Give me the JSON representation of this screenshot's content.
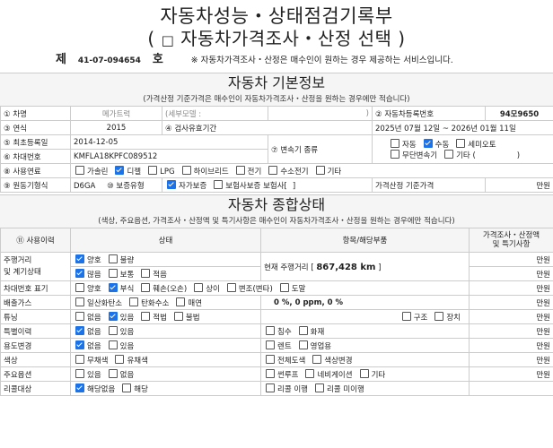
{
  "title": {
    "line1": "자동차성능・상태점검기록부",
    "line2_open": "( ",
    "line2_checkbox": "□",
    "line2_text": "자동차가격조사・산정 선택",
    "line2_close": " )"
  },
  "number_line": {
    "prefix": "제",
    "number": "41-07-094654",
    "suffix": "호",
    "note": "※ 자동차가격조사・산정은 매수인이 원하는 경우 제공하는 서비스입니다."
  },
  "basic_info": {
    "heading": "자동차 기본정보",
    "subheading": "(가격산정 기준가격은 매수인이 자동차가격조사・산정을 원하는 경우에만 적습니다)",
    "car_name_label": "① 차명",
    "car_name_value": "메가트럭",
    "detail_model_label": "(세부모델 :",
    "detail_model_close": ")",
    "reg_no_label": "② 자동차등록번호",
    "reg_no_value": "94모9650",
    "year_label": "③ 연식",
    "year_value": "2015",
    "inspection_label": "④ 검사유효기간",
    "inspection_value": "2025년 07월 12일 ~ 2026년 01월 11일",
    "first_reg_label": "⑤ 최초등록일",
    "first_reg_value": "2014-12-05",
    "vin_label": "⑥ 차대번호",
    "vin_value": "KMFLA18KPFC089512",
    "transmission_label": "⑦ 변속기 종류",
    "transmission_options": [
      {
        "label": "자동",
        "checked": false
      },
      {
        "label": "수동",
        "checked": true
      },
      {
        "label": "세미오토",
        "checked": false
      },
      {
        "label": "무단변속기",
        "checked": false
      },
      {
        "label": "기타 (",
        "checked": false
      }
    ],
    "transmission_other_close": ")",
    "fuel_label": "⑧ 사용연료",
    "fuel_options": [
      {
        "label": "가솔린",
        "checked": false
      },
      {
        "label": "디젤",
        "checked": true
      },
      {
        "label": "LPG",
        "checked": false
      },
      {
        "label": "하이브리드",
        "checked": false
      },
      {
        "label": "전기",
        "checked": false
      },
      {
        "label": "수소전기",
        "checked": false
      },
      {
        "label": "기타",
        "checked": false
      }
    ],
    "motor_label": "⑨ 원동기형식",
    "motor_value": "D6GA",
    "warranty_label": "⑩ 보증유형",
    "warranty_options": [
      {
        "label": "자가보증",
        "checked": true
      },
      {
        "label": "보험사보증 보험사[",
        "checked": false
      }
    ],
    "warranty_close": "]",
    "price_base_label": "가격산정 기준가격",
    "price_base_unit": "만원"
  },
  "overall_status": {
    "heading": "자동차 종합상태",
    "subheading": "(색상, 주요옵션, 가격조사・산정액 및 특기사항은 매수인이 자동차가격조사・산정을 원하는 경우에만 적습니다)",
    "col_usage": "⑪ 사용이력",
    "col_status": "상태",
    "col_items": "항목/해당부품",
    "col_price_line1": "가격조사・산정액",
    "col_price_line2": "및 특기사항",
    "unit": "만원",
    "mileage_label_1": "주행거리",
    "mileage_label_2": "및 계기상태",
    "mileage_row1": [
      {
        "label": "양호",
        "checked": true
      },
      {
        "label": "불량",
        "checked": false
      }
    ],
    "mileage_row2": [
      {
        "label": "많음",
        "checked": true
      },
      {
        "label": "보통",
        "checked": false
      },
      {
        "label": "적음",
        "checked": false
      }
    ],
    "current_mileage_label": "현재 주행거리 [",
    "current_mileage_value": "867,428 km",
    "current_mileage_close": "]",
    "vin_mark_label": "차대번호 표기",
    "vin_mark_options": [
      {
        "label": "양호",
        "checked": false
      },
      {
        "label": "부식",
        "checked": true
      },
      {
        "label": "훼손(오손)",
        "checked": false
      },
      {
        "label": "상이",
        "checked": false
      },
      {
        "label": "변조(변타)",
        "checked": false
      },
      {
        "label": "도말",
        "checked": false
      }
    ],
    "emission_label": "배출가스",
    "emission_options": [
      {
        "label": "일산화탄소",
        "checked": false
      },
      {
        "label": "탄화수소",
        "checked": false
      },
      {
        "label": "매연",
        "checked": false
      }
    ],
    "emission_values": "0 %,   0 ppm,   0 %",
    "tuning_label": "튜닝",
    "tuning_options": [
      {
        "label": "없음",
        "checked": false
      },
      {
        "label": "있음",
        "checked": true
      },
      {
        "label": "적법",
        "checked": false
      },
      {
        "label": "불법",
        "checked": false
      }
    ],
    "tuning_items": [
      {
        "label": "구조",
        "checked": false
      },
      {
        "label": "장치",
        "checked": false
      }
    ],
    "special_label": "특별이력",
    "special_options": [
      {
        "label": "없음",
        "checked": true
      },
      {
        "label": "있음",
        "checked": false
      }
    ],
    "special_items": [
      {
        "label": "침수",
        "checked": false
      },
      {
        "label": "화재",
        "checked": false
      }
    ],
    "use_change_label": "용도변경",
    "use_change_options": [
      {
        "label": "없음",
        "checked": true
      },
      {
        "label": "있음",
        "checked": false
      }
    ],
    "use_change_items": [
      {
        "label": "렌트",
        "checked": false
      },
      {
        "label": "영업용",
        "checked": false
      }
    ],
    "color_label": "색상",
    "color_options": [
      {
        "label": "무채색",
        "checked": false
      },
      {
        "label": "유채색",
        "checked": false
      }
    ],
    "color_items": [
      {
        "label": "전체도색",
        "checked": false
      },
      {
        "label": "색상변경",
        "checked": false
      }
    ],
    "options_label": "주요옵션",
    "options_options": [
      {
        "label": "있음",
        "checked": false
      },
      {
        "label": "없음",
        "checked": false
      }
    ],
    "options_items": [
      {
        "label": "썬루프",
        "checked": false
      },
      {
        "label": "네비게이션",
        "checked": false
      },
      {
        "label": "기타",
        "checked": false
      }
    ],
    "recall_label": "리콜대상",
    "recall_options": [
      {
        "label": "해당없음",
        "checked": true
      },
      {
        "label": "해당",
        "checked": false
      }
    ],
    "recall_items": [
      {
        "label": "리콜 이행",
        "checked": false
      },
      {
        "label": "리콜 미이행",
        "checked": false
      }
    ]
  }
}
